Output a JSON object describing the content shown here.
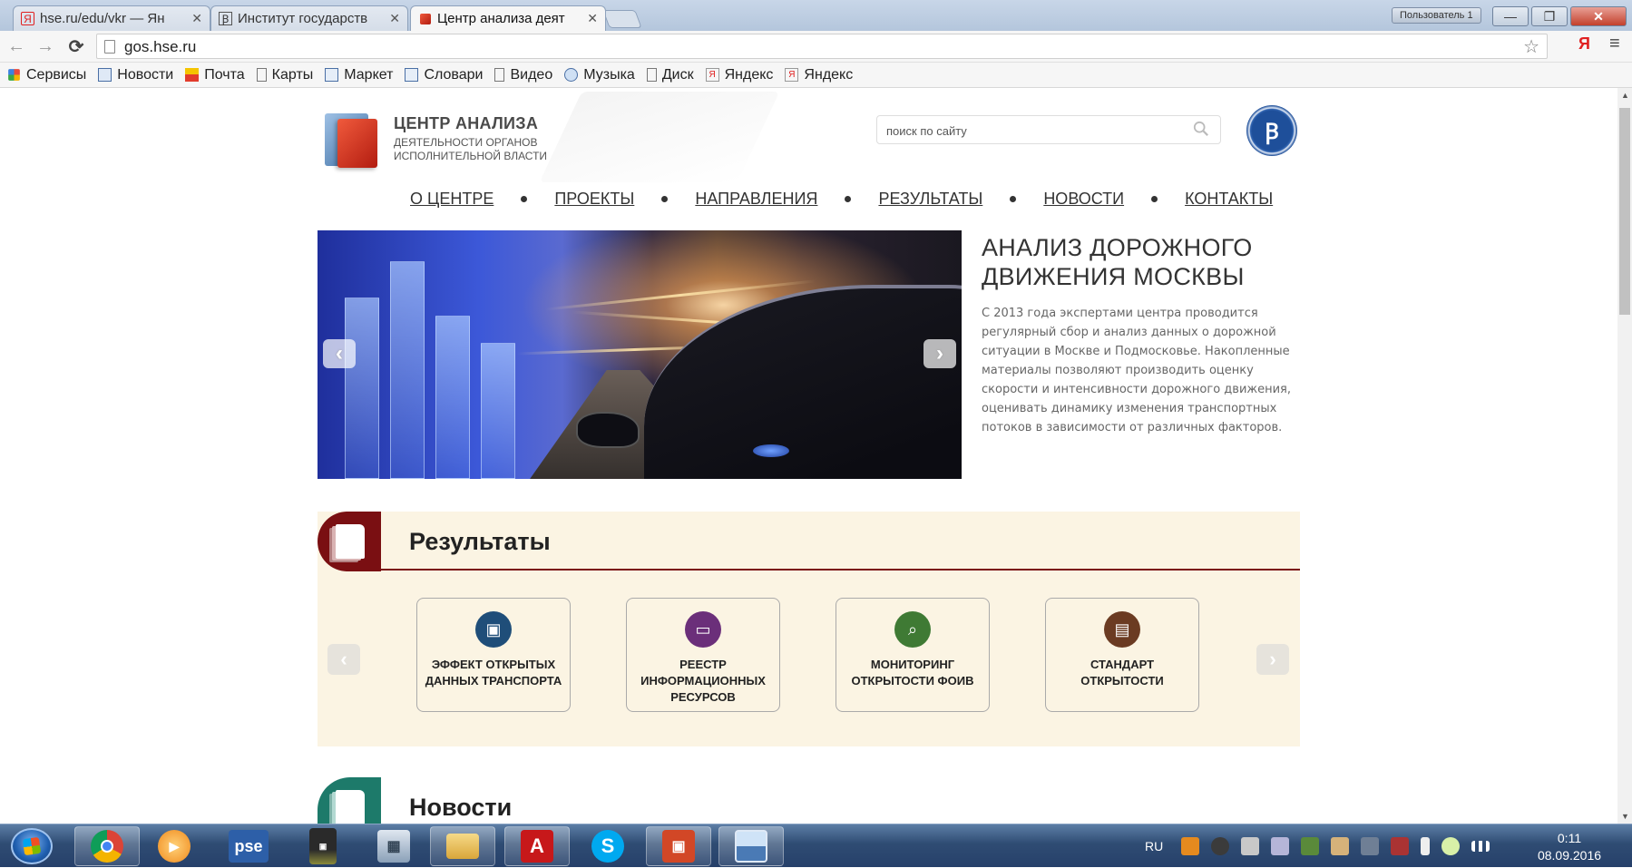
{
  "browser": {
    "tabs": [
      {
        "title": "hse.ru/edu/vkr — Ян",
        "icon": "yandex-icon",
        "active": false
      },
      {
        "title": "Институт государств",
        "icon": "hse-icon",
        "active": false
      },
      {
        "title": "Центр анализа деят",
        "icon": "site-favicon",
        "active": true
      }
    ],
    "user_badge": "Пользователь 1",
    "window_controls": {
      "minimize": "—",
      "maximize": "❐",
      "close": "✕"
    },
    "nav": {
      "back": "←",
      "forward": "→",
      "reload": "C"
    },
    "url": "gos.hse.ru",
    "yandex_button": "Я",
    "menu_button": "≡",
    "bookmarks": [
      {
        "label": "Сервисы",
        "icon": "apps-icon"
      },
      {
        "label": "Новости",
        "icon": "news-icon"
      },
      {
        "label": "Почта",
        "icon": "mail-icon"
      },
      {
        "label": "Карты",
        "icon": "page-icon"
      },
      {
        "label": "Маркет",
        "icon": "market-icon"
      },
      {
        "label": "Словари",
        "icon": "dictionary-icon"
      },
      {
        "label": "Видео",
        "icon": "page-icon"
      },
      {
        "label": "Музыка",
        "icon": "music-icon"
      },
      {
        "label": "Диск",
        "icon": "page-icon"
      },
      {
        "label": "Яндекс",
        "icon": "yandex-icon"
      },
      {
        "label": "Яндекс",
        "icon": "yandex-icon"
      }
    ]
  },
  "site": {
    "logo": {
      "title": "ЦЕНТР АНАЛИЗА",
      "subtitle_line1": "ДЕЯТЕЛЬНОСТИ ОРГАНОВ",
      "subtitle_line2": "ИСПОЛНИТЕЛЬНОЙ ВЛАСТИ"
    },
    "search": {
      "placeholder": "поиск по сайту"
    },
    "nav": [
      "О ЦЕНТРЕ",
      "ПРОЕКТЫ",
      "НАПРАВЛЕНИЯ",
      "РЕЗУЛЬТАТЫ",
      "НОВОСТИ",
      "КОНТАКТЫ"
    ],
    "hero": {
      "title": "АНАЛИЗ ДОРОЖНОГО ДВИЖЕНИЯ МОСКВЫ",
      "description": "С 2013 года экспертами центра проводится регулярный сбор и анализ данных о дорожной ситуации в Москве и Подмосковье. Накопленные материалы позволяют производить оценку скорости и интенсивности дорожного движения, оценивать динамику изменения транспортных потоков в зависимости от различных факторов.",
      "prev": "‹",
      "next": "›"
    },
    "results": {
      "title": "Результаты",
      "cards": [
        {
          "label": "ЭФФЕКТ ОТКРЫТЫХ ДАННЫХ ТРАНСПОРТА",
          "color": "#1f4e79",
          "icon": "document-icon"
        },
        {
          "label": "РЕЕСТР ИНФОРМАЦИОННЫХ РЕСУРСОВ",
          "color": "#6b2f7a",
          "icon": "monitor-icon"
        },
        {
          "label": "МОНИТОРИНГ ОТКРЫТОСТИ ФОИВ",
          "color": "#3f7a34",
          "icon": "magnifier-icon"
        },
        {
          "label": "СТАНДАРТ ОТКРЫТОСТИ",
          "color": "#6b3b22",
          "icon": "presenter-icon"
        }
      ],
      "prev": "‹",
      "next": "›"
    },
    "news": {
      "title": "Новости"
    }
  },
  "taskbar": {
    "apps": [
      {
        "name": "chrome-taskbar-app",
        "label": "",
        "color": "#e04b3a"
      },
      {
        "name": "media-player-taskbar-app",
        "label": "",
        "color": "#f08a1c"
      },
      {
        "name": "pse-taskbar-app",
        "label": "pse",
        "color": "#2d5fa8"
      },
      {
        "name": "dolby-taskbar-app",
        "label": "",
        "color": "#2a2a2a"
      },
      {
        "name": "calculator-taskbar-app",
        "label": "",
        "color": "#8aa0b8"
      },
      {
        "name": "explorer-taskbar-app",
        "label": "",
        "color": "#e8c25a"
      },
      {
        "name": "acrobat-taskbar-app",
        "label": "",
        "color": "#c7181a"
      },
      {
        "name": "skype-taskbar-app",
        "label": "S",
        "color": "#00a9f0"
      },
      {
        "name": "powerpoint-taskbar-app",
        "label": "",
        "color": "#d24726"
      },
      {
        "name": "picture-viewer-taskbar-app",
        "label": "",
        "color": "#4a7ab5"
      }
    ],
    "language": "RU",
    "time": "0:11",
    "date": "08.09.2016"
  }
}
